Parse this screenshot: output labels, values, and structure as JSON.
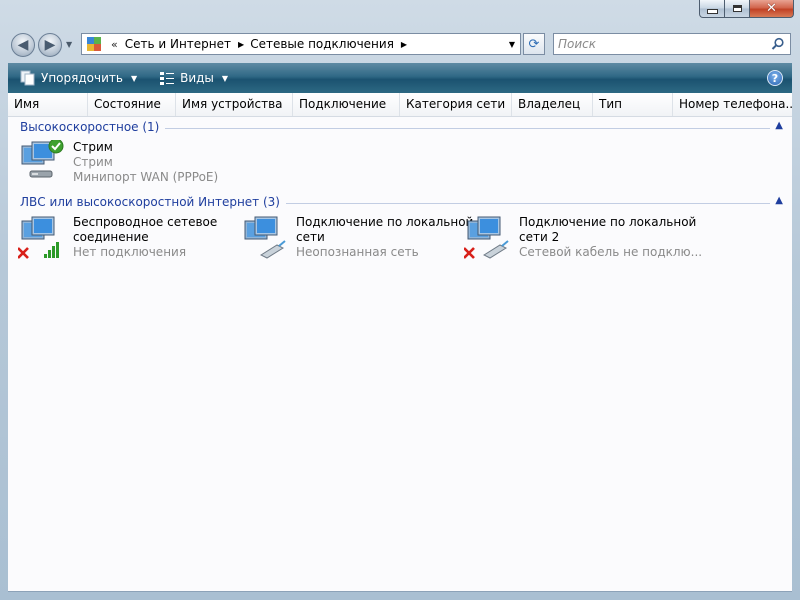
{
  "window": {
    "buttons": {
      "minimize": "minimize-icon",
      "maximize": "maximize-icon",
      "close": "close-icon"
    }
  },
  "nav": {
    "back_icon": "back-arrow-icon",
    "forward_icon": "forward-arrow-icon"
  },
  "address": {
    "overflow": "«",
    "crumbs": [
      "Сеть и Интернет",
      "Сетевые подключения"
    ]
  },
  "search": {
    "placeholder": "Поиск"
  },
  "toolbar": {
    "organize_label": "Упорядочить",
    "views_label": "Виды",
    "help": "?"
  },
  "columns": [
    "Имя",
    "Состояние",
    "Имя устройства",
    "Подключение",
    "Категория сети",
    "Владелец",
    "Тип",
    "Номер телефона..."
  ],
  "groups": [
    {
      "title": "Высокоскоростное (1)",
      "items": [
        {
          "name": "Стрим",
          "line2": "Стрим",
          "line3": "Минипорт WAN (PPPoE)",
          "status_icon": "connected-check-icon"
        }
      ]
    },
    {
      "title": "ЛВС или высокоскоростной Интернет (3)",
      "items": [
        {
          "name": "Беспроводное сетевое",
          "name2": "соединение",
          "status": "Нет подключения",
          "status_icon": "disconnected-x-icon"
        },
        {
          "name": "Подключение по локальной",
          "name2": "сети",
          "status": "Неопознанная сеть",
          "status_icon": ""
        },
        {
          "name": "Подключение по локальной",
          "name2": "сети 2",
          "status": "Сетевой кабель не подклю...",
          "status_icon": "disconnected-x-icon"
        }
      ]
    }
  ],
  "colors": {
    "group_title": "#1f3e9e",
    "toolbar": "#1b5270",
    "gray_text": "#8a8a8a"
  }
}
